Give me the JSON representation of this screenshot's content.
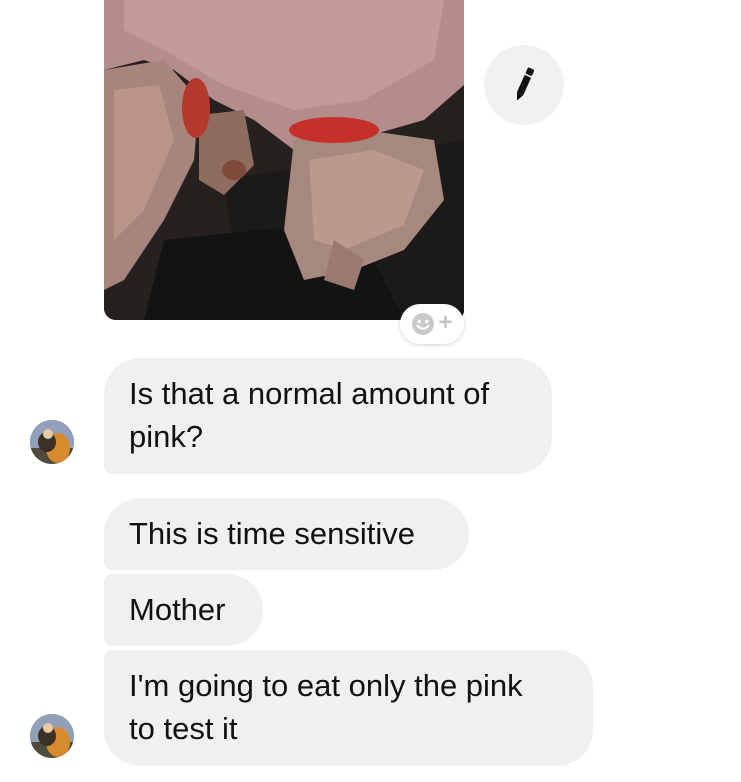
{
  "conversation": {
    "messages": [
      {
        "text": "Is that a normal amount of\npink?"
      },
      {
        "text": "This is time sensitive"
      },
      {
        "text": "Mother"
      },
      {
        "text": "I'm going to eat only the pink\nto test it"
      }
    ]
  },
  "icons": {
    "edit": "pencil-icon",
    "reaction": "smiley-add-icon",
    "avatar": "contact-avatar"
  },
  "colors": {
    "bubble_background": "#f1f0f0",
    "text": "#111111",
    "icon_button_background": "#f1f1f1"
  }
}
